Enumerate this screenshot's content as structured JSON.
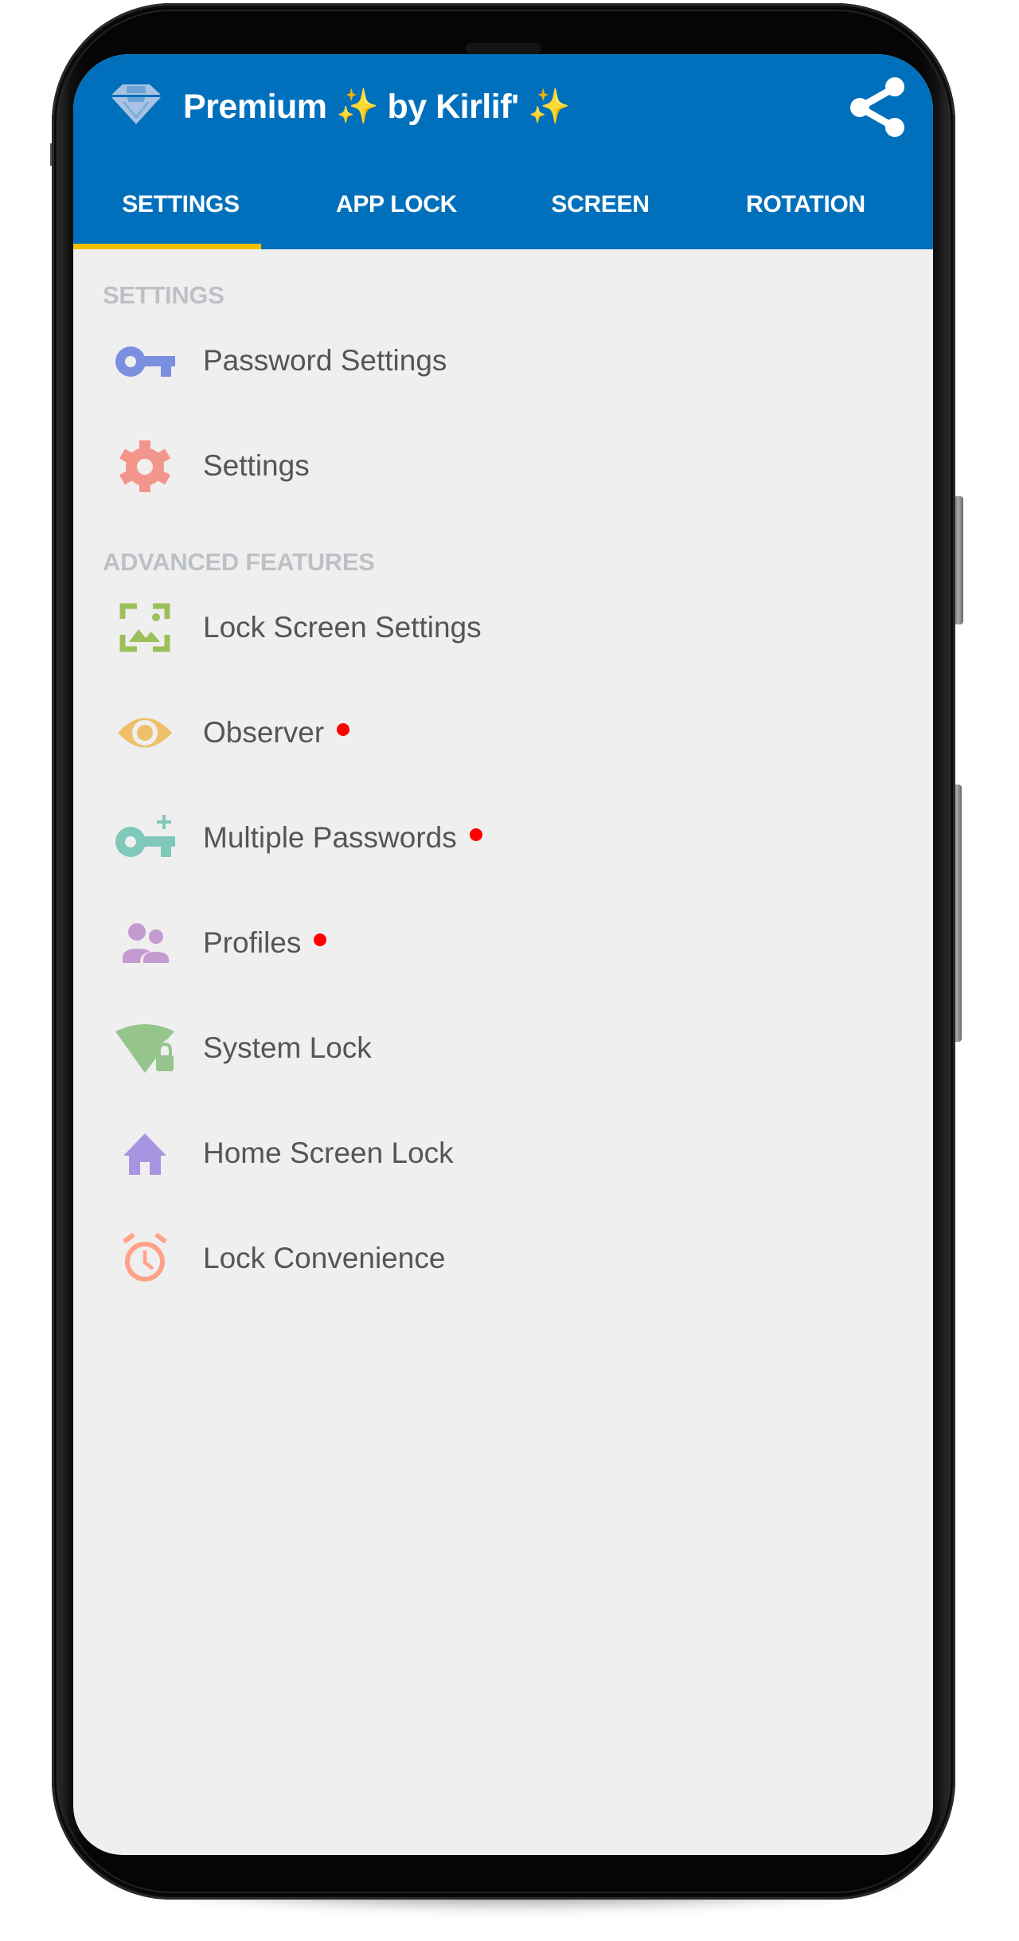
{
  "app": {
    "title": "Premium  ✨ by Kirlif' ✨",
    "app_icon": "diamond-icon",
    "share_icon": "share-icon"
  },
  "tabs": [
    {
      "label": "SETTINGS",
      "selected": true
    },
    {
      "label": "APP LOCK",
      "selected": false
    },
    {
      "label": "SCREEN",
      "selected": false
    },
    {
      "label": "ROTATION",
      "selected": false
    }
  ],
  "sections": [
    {
      "header": "SETTINGS",
      "items": [
        {
          "label": "Password Settings",
          "icon": "key-icon",
          "color": "#7B8FE0",
          "badge": false
        },
        {
          "label": "Settings",
          "icon": "gear-icon",
          "color": "#F2958A",
          "badge": false
        }
      ]
    },
    {
      "header": "ADVANCED FEATURES",
      "items": [
        {
          "label": "Lock Screen Settings",
          "icon": "wallpaper-icon",
          "color": "#9CBF5A",
          "badge": false
        },
        {
          "label": "Observer",
          "icon": "eye-icon",
          "color": "#EEC06A",
          "badge": true
        },
        {
          "label": "Multiple Passwords",
          "icon": "key-plus-icon",
          "color": "#80C8BA",
          "badge": true
        },
        {
          "label": "Profiles",
          "icon": "people-icon",
          "color": "#C39BD0",
          "badge": true
        },
        {
          "label": "System Lock",
          "icon": "signal-lock-icon",
          "color": "#95C58D",
          "badge": false
        },
        {
          "label": "Home Screen Lock",
          "icon": "home-icon",
          "color": "#A895E2",
          "badge": false
        },
        {
          "label": "Lock Convenience",
          "icon": "alarm-clock-icon",
          "color": "#FFA28A",
          "badge": false
        }
      ]
    }
  ],
  "colors": {
    "appbar": "#0170BC",
    "tab_indicator": "#F5BE00",
    "background": "#EFEFEF",
    "section_header": "#BDC1C6",
    "item_text": "#555555",
    "badge": "#FF0000"
  }
}
